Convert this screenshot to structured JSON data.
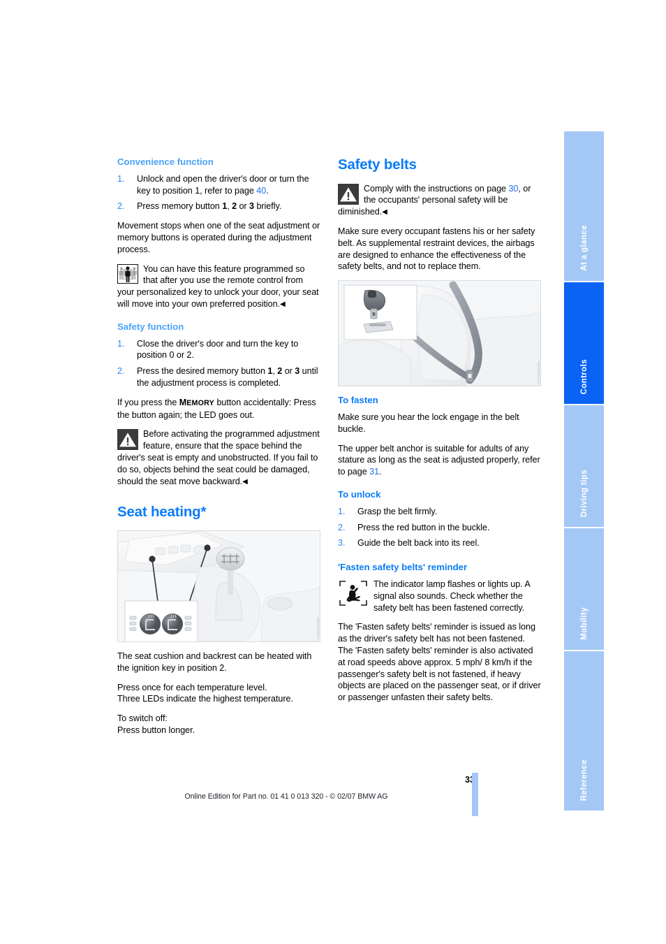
{
  "document": {
    "page_number": "33",
    "footer": "Online Edition for Part no. 01 41 0 013 320 - © 02/07 BMW AG"
  },
  "tabs": [
    {
      "label": "At a glance",
      "active": false
    },
    {
      "label": "Controls",
      "active": true
    },
    {
      "label": "Driving tips",
      "active": false
    },
    {
      "label": "Mobility",
      "active": false
    },
    {
      "label": "Reference",
      "active": false
    }
  ],
  "left_column": {
    "convenience": {
      "heading": "Convenience function",
      "steps": [
        {
          "num": "1.",
          "text_a": "Unlock and open the driver's door or turn the key to position 1, refer to page ",
          "pageref": "40",
          "text_b": "."
        },
        {
          "num": "2.",
          "text_a": "Press memory button ",
          "b1": "1",
          "mid1": ", ",
          "b2": "2",
          "mid2": " or ",
          "b3": "3",
          "text_b": " briefly."
        }
      ],
      "paragraph": "Movement stops when one of the seat adjustment or memory buttons is operated during the adjustment process.",
      "note": {
        "icon": "personal-program-icon",
        "text": "You can have this feature programmed so that after you use the remote control from your personalized key to unlock your door, your seat will move into your own preferred position.",
        "endmark": "◀"
      }
    },
    "safety_function": {
      "heading": "Safety function",
      "steps": [
        {
          "num": "1.",
          "text_a": "Close the driver's door and turn the key to position 0 or 2."
        },
        {
          "num": "2.",
          "text_a": "Press the desired memory button ",
          "b1": "1",
          "mid1": ", ",
          "b2": "2",
          "mid2": " or ",
          "b3": "3",
          "text_b": " until the adjustment process is completed."
        }
      ],
      "accidental_a": "If you press the ",
      "accidental_m": "M",
      "accidental_caps": "EMORY",
      "accidental_b": " button accidentally: Press the button again; the LED goes out.",
      "warning": {
        "icon": "warning-triangle-icon",
        "text": "Before activating the programmed adjustment feature, ensure that the space behind the driver's seat is empty and unobstructed. If you fail to do so, objects behind the seat could be damaged, should the seat move backward.",
        "endmark": "◀"
      }
    },
    "seat_heating": {
      "heading": "Seat heating*",
      "figure_alt": "seat-heating-buttons-center-console",
      "figure_watermark": "WW0000000AA",
      "paragraphs": [
        "The seat cushion and backrest can be heated with the ignition key in position 2.",
        "Press once for each temperature level.\nThree LEDs indicate the highest temperature.",
        "To switch off:\nPress button longer."
      ]
    }
  },
  "right_column": {
    "safety_belts": {
      "heading": "Safety belts",
      "warning": {
        "icon": "warning-triangle-icon",
        "text_a": "Comply with the instructions on page ",
        "pageref": "30",
        "text_b": ", or the occupants' personal safety will be diminished.",
        "endmark": "◀"
      },
      "paragraph": "Make sure every occupant fastens his or her safety belt. As supplemental restraint devices, the airbags are designed to enhance the effectiveness of the safety belts, and not to replace them.",
      "figure_alt": "safety-belt-on-seat-with-buckle-inset",
      "figure_watermark": "WW0000000AA"
    },
    "to_fasten": {
      "heading": "To fasten",
      "paragraph_1": "Make sure you hear the lock engage in the belt buckle.",
      "paragraph_2_a": "The upper belt anchor is suitable for adults of any stature as long as the seat is adjusted properly, refer to page ",
      "paragraph_2_pageref": "31",
      "paragraph_2_b": "."
    },
    "to_unlock": {
      "heading": "To unlock",
      "steps": [
        {
          "num": "1.",
          "text_a": "Grasp the belt firmly."
        },
        {
          "num": "2.",
          "text_a": "Press the red button in the buckle."
        },
        {
          "num": "3.",
          "text_a": "Guide the belt back into its reel."
        }
      ]
    },
    "reminder": {
      "heading": "'Fasten safety belts' reminder",
      "note": {
        "icon": "seatbelt-warning-lamp-icon",
        "text": "The indicator lamp flashes or lights up. A signal also sounds. Check whether the safety belt has been fastened correctly."
      },
      "paragraph": "The 'Fasten safety belts' reminder is issued as long as the driver's safety belt has not been fastened. The 'Fasten safety belts' reminder is also activated at road speeds above approx. 5 mph/ 8 km/h if the passenger's safety belt is not fastened, if heavy objects are placed on the passenger seat, or if driver or passenger unfasten their safety belts."
    }
  },
  "colors": {
    "heading_blue": "#0a7cf7",
    "subheading_blue": "#4ba3f7",
    "tab_inactive": "#a4c8f5",
    "tab_active": "#0a63f5",
    "pageref_blue": "#1f6feb"
  }
}
